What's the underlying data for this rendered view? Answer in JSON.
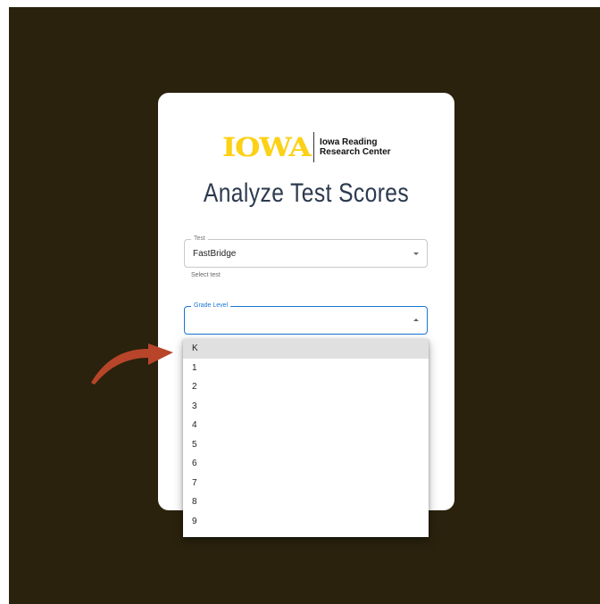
{
  "logo": {
    "wordmark": "IOWA",
    "center_line1": "Iowa Reading",
    "center_line2": "Research Center"
  },
  "page": {
    "title": "Analyze Test Scores"
  },
  "test_field": {
    "label": "Test",
    "value": "FastBridge",
    "helper": "Select test"
  },
  "grade_field": {
    "label": "Grade Level",
    "value": ""
  },
  "grade_options": [
    "K",
    "1",
    "2",
    "3",
    "4",
    "5",
    "6",
    "7",
    "8",
    "9"
  ],
  "highlighted_option": "K",
  "colors": {
    "background": "#2a220d",
    "brand_gold": "#fcd116",
    "title": "#2c3a4f",
    "focus": "#1976d2",
    "arrow": "#b8452a"
  }
}
